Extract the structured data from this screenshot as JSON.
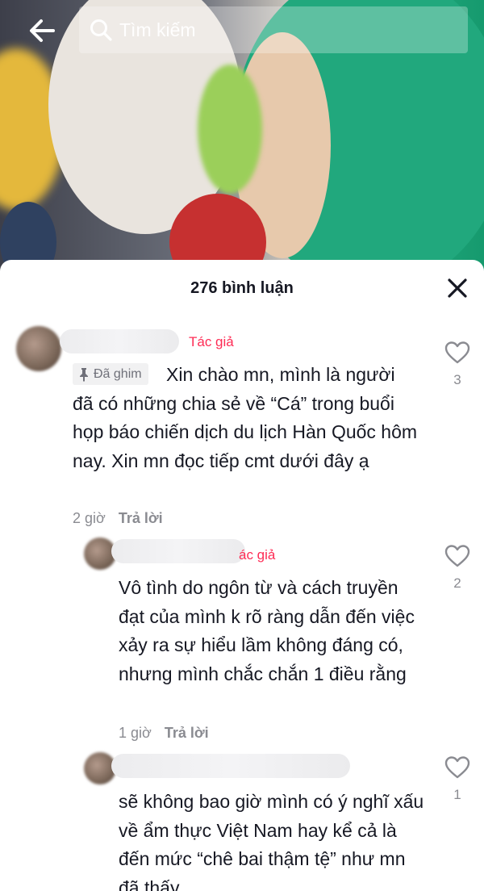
{
  "search": {
    "placeholder": "Tìm kiếm"
  },
  "sheet": {
    "comment_count": "276 bình luận"
  },
  "comments": [
    {
      "author_badge": "Tác giả",
      "pinned_label": "Đã ghim",
      "text": "Xin chào mn, mình là người đã có những chia sẻ về “Cá” trong buổi họp báo chiến dịch du lịch Hàn Quốc hôm nay. Xin mn đọc tiếp cmt dưới đây ạ",
      "time": "2 giờ",
      "reply_label": "Trả lời",
      "likes": "3"
    },
    {
      "author_badge": "ác giả",
      "text": "Vô tình do ngôn từ và cách truyền đạt của mình k rõ ràng dẫn đến việc xảy ra sự hiểu lầm không đáng có, nhưng mình chắc chắn 1 điều rằng",
      "time": "1 giờ",
      "reply_label": "Trả lời",
      "likes": "2"
    },
    {
      "text": "sẽ không bao giờ mình có ý nghĩ xấu về ẩm thực Việt Nam hay kể cả là đến mức “chê bai thậm tệ” như mn đã thấy",
      "likes": "1"
    }
  ],
  "icons": {
    "back": "arrow-left-icon",
    "search": "search-icon",
    "close": "close-icon",
    "pin": "pin-icon",
    "like": "heart-icon"
  },
  "colors": {
    "accent": "#fe2c55",
    "text": "#161823",
    "muted": "#8a8b91"
  }
}
